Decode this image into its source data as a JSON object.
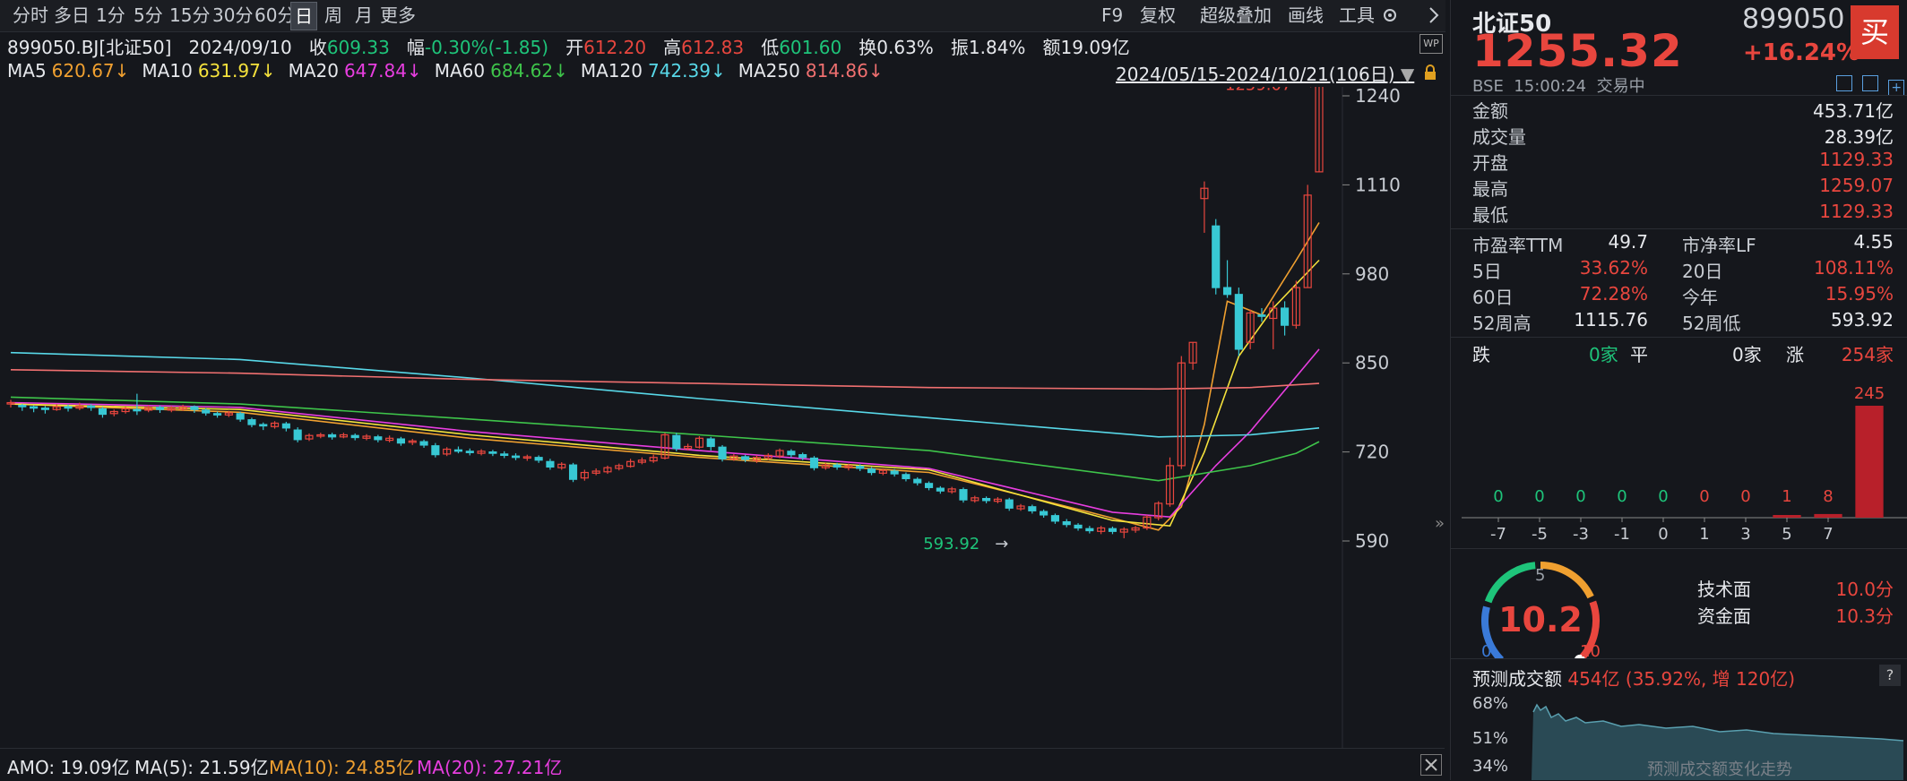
{
  "toolbar": {
    "periods": [
      "分时",
      "多日",
      "1分",
      "5分",
      "15分",
      "30分",
      "60分",
      "日",
      "周",
      "月",
      "更多"
    ],
    "active_period": "日",
    "right_items": [
      "F9",
      "复权",
      "超级叠加",
      "画线",
      "工具"
    ]
  },
  "info": {
    "code": "899050.BJ[北证50]",
    "date": "2024/09/10",
    "close_label": "收",
    "close": "609.33",
    "amp_label": "幅",
    "amp": "-0.30%(-1.85)",
    "open_label": "开",
    "open": "612.20",
    "high_label": "高",
    "high": "612.83",
    "low_label": "低",
    "low": "601.60",
    "turnover_label": "换",
    "turnover": "0.63%",
    "swing_label": "振",
    "swing": "1.84%",
    "amount_label": "额",
    "amount": "19.09亿"
  },
  "ma_legend": [
    {
      "name": "MA5",
      "value": "620.67↓",
      "color": "#f0a030"
    },
    {
      "name": "MA10",
      "value": "631.97↓",
      "color": "#f5e23c"
    },
    {
      "name": "MA20",
      "value": "647.84↓",
      "color": "#e83ee0"
    },
    {
      "name": "MA60",
      "value": "684.62↓",
      "color": "#3ec44a"
    },
    {
      "name": "MA120",
      "value": "742.39↓",
      "color": "#58d8e8"
    },
    {
      "name": "MA250",
      "value": "814.86↓",
      "color": "#f07070"
    }
  ],
  "range_label": "2024/05/15-2024/10/21(106日)",
  "chart_data": {
    "type": "candlestick",
    "y_ticks": [
      "1240",
      "1110",
      "980",
      "850",
      "720",
      "590"
    ],
    "y_tick_values": [
      1240,
      1110,
      980,
      850,
      720,
      590
    ],
    "ylim": [
      575,
      1270
    ],
    "high_marker": "1259.07",
    "low_marker": "593.92",
    "candles": [
      [
        790,
        792,
        785,
        796
      ],
      [
        788,
        786,
        780,
        790
      ],
      [
        786,
        784,
        778,
        788
      ],
      [
        784,
        782,
        776,
        787
      ],
      [
        782,
        786,
        780,
        790
      ],
      [
        786,
        784,
        779,
        789
      ],
      [
        784,
        787,
        781,
        792
      ],
      [
        787,
        785,
        780,
        790
      ],
      [
        783,
        775,
        770,
        786
      ],
      [
        776,
        779,
        772,
        782
      ],
      [
        779,
        783,
        776,
        786
      ],
      [
        782,
        780,
        774,
        805
      ],
      [
        781,
        785,
        778,
        788
      ],
      [
        785,
        782,
        777,
        788
      ],
      [
        781,
        784,
        778,
        787
      ],
      [
        783,
        786,
        780,
        789
      ],
      [
        786,
        782,
        777,
        788
      ],
      [
        781,
        777,
        773,
        784
      ],
      [
        776,
        775,
        770,
        779
      ],
      [
        774,
        777,
        771,
        780
      ],
      [
        776,
        768,
        764,
        779
      ],
      [
        767,
        760,
        756,
        770
      ],
      [
        760,
        758,
        752,
        763
      ],
      [
        757,
        762,
        754,
        765
      ],
      [
        761,
        755,
        750,
        764
      ],
      [
        752,
        738,
        734,
        756
      ],
      [
        739,
        744,
        736,
        747
      ],
      [
        743,
        745,
        740,
        748
      ],
      [
        745,
        742,
        738,
        748
      ],
      [
        742,
        745,
        740,
        748
      ],
      [
        744,
        741,
        737,
        747
      ],
      [
        740,
        743,
        737,
        746
      ],
      [
        742,
        738,
        734,
        745
      ],
      [
        737,
        740,
        734,
        744
      ],
      [
        739,
        733,
        729,
        742
      ],
      [
        734,
        736,
        730,
        739
      ],
      [
        735,
        730,
        726,
        738
      ],
      [
        729,
        716,
        712,
        733
      ],
      [
        717,
        724,
        714,
        727
      ],
      [
        723,
        722,
        718,
        728
      ],
      [
        721,
        719,
        715,
        725
      ],
      [
        718,
        721,
        715,
        724
      ],
      [
        720,
        718,
        714,
        723
      ],
      [
        717,
        715,
        711,
        721
      ],
      [
        714,
        712,
        708,
        718
      ],
      [
        711,
        713,
        707,
        716
      ],
      [
        712,
        708,
        704,
        715
      ],
      [
        706,
        698,
        694,
        710
      ],
      [
        697,
        702,
        694,
        705
      ],
      [
        701,
        680,
        676,
        704
      ],
      [
        682,
        690,
        678,
        694
      ],
      [
        689,
        692,
        686,
        696
      ],
      [
        691,
        697,
        688,
        700
      ],
      [
        696,
        700,
        693,
        703
      ],
      [
        699,
        706,
        697,
        710
      ],
      [
        705,
        708,
        702,
        712
      ],
      [
        707,
        712,
        704,
        716
      ],
      [
        711,
        745,
        709,
        748
      ],
      [
        744,
        725,
        721,
        748
      ],
      [
        725,
        728,
        722,
        732
      ],
      [
        727,
        740,
        725,
        743
      ],
      [
        739,
        728,
        722,
        742
      ],
      [
        727,
        710,
        706,
        730
      ],
      [
        710,
        714,
        707,
        717
      ],
      [
        713,
        709,
        705,
        716
      ],
      [
        708,
        712,
        704,
        715
      ],
      [
        711,
        715,
        708,
        718
      ],
      [
        714,
        722,
        711,
        725
      ],
      [
        721,
        716,
        712,
        724
      ],
      [
        716,
        712,
        708,
        719
      ],
      [
        711,
        697,
        693,
        714
      ],
      [
        697,
        701,
        694,
        704
      ],
      [
        701,
        698,
        694,
        704
      ],
      [
        697,
        700,
        693,
        703
      ],
      [
        699,
        696,
        692,
        702
      ],
      [
        695,
        690,
        686,
        698
      ],
      [
        689,
        693,
        686,
        696
      ],
      [
        692,
        688,
        684,
        695
      ],
      [
        687,
        681,
        677,
        690
      ],
      [
        680,
        675,
        671,
        683
      ],
      [
        674,
        668,
        664,
        677
      ],
      [
        667,
        663,
        659,
        670
      ],
      [
        662,
        666,
        659,
        669
      ],
      [
        665,
        650,
        646,
        668
      ],
      [
        649,
        653,
        646,
        656
      ],
      [
        652,
        649,
        645,
        655
      ],
      [
        648,
        651,
        645,
        654
      ],
      [
        650,
        638,
        634,
        653
      ],
      [
        637,
        641,
        634,
        644
      ],
      [
        640,
        634,
        630,
        643
      ],
      [
        633,
        628,
        624,
        636
      ],
      [
        627,
        619,
        615,
        630
      ],
      [
        618,
        614,
        610,
        622
      ],
      [
        613,
        609,
        605,
        616
      ],
      [
        608,
        605,
        601,
        612
      ],
      [
        604,
        609,
        600,
        612
      ],
      [
        608,
        604,
        600,
        611
      ],
      [
        603,
        607,
        594,
        610
      ],
      [
        606,
        609,
        602,
        612
      ],
      [
        609,
        625,
        606,
        628
      ],
      [
        624,
        645,
        620,
        648
      ],
      [
        644,
        700,
        640,
        712
      ],
      [
        700,
        850,
        695,
        860
      ],
      [
        850,
        880,
        840,
        880
      ],
      [
        1090,
        1105,
        1040,
        1115
      ],
      [
        1050,
        960,
        950,
        1060
      ],
      [
        960,
        950,
        945,
        1000
      ],
      [
        950,
        870,
        860,
        960
      ],
      [
        880,
        923,
        870,
        928
      ],
      [
        920,
        918,
        910,
        930
      ],
      [
        915,
        930,
        870,
        940
      ],
      [
        930,
        905,
        890,
        940
      ],
      [
        905,
        960,
        900,
        970
      ],
      [
        960,
        1095,
        960,
        1110
      ],
      [
        1129,
        1255,
        1129,
        1259
      ]
    ],
    "ma_lines": {
      "MA5": [
        [
          0,
          790
        ],
        [
          20,
          778
        ],
        [
          40,
          740
        ],
        [
          60,
          712
        ],
        [
          80,
          690
        ],
        [
          94,
          632
        ],
        [
          100,
          606
        ],
        [
          102,
          640
        ],
        [
          104,
          760
        ],
        [
          106,
          940
        ],
        [
          109,
          920
        ],
        [
          112,
          1000
        ],
        [
          114,
          1055
        ]
      ],
      "MA10": [
        [
          0,
          790
        ],
        [
          20,
          782
        ],
        [
          40,
          745
        ],
        [
          60,
          715
        ],
        [
          80,
          694
        ],
        [
          96,
          620
        ],
        [
          101,
          612
        ],
        [
          104,
          720
        ],
        [
          107,
          860
        ],
        [
          110,
          930
        ],
        [
          114,
          1000
        ]
      ],
      "MA20": [
        [
          0,
          792
        ],
        [
          20,
          785
        ],
        [
          40,
          750
        ],
        [
          60,
          722
        ],
        [
          80,
          696
        ],
        [
          96,
          632
        ],
        [
          101,
          625
        ],
        [
          105,
          700
        ],
        [
          108,
          750
        ],
        [
          112,
          830
        ],
        [
          114,
          870
        ]
      ],
      "MA60": [
        [
          0,
          800
        ],
        [
          20,
          790
        ],
        [
          40,
          768
        ],
        [
          60,
          745
        ],
        [
          80,
          722
        ],
        [
          100,
          678
        ],
        [
          108,
          700
        ],
        [
          112,
          718
        ],
        [
          114,
          735
        ]
      ],
      "MA120": [
        [
          0,
          865
        ],
        [
          20,
          855
        ],
        [
          40,
          828
        ],
        [
          60,
          798
        ],
        [
          80,
          770
        ],
        [
          100,
          742
        ],
        [
          108,
          745
        ],
        [
          114,
          755
        ]
      ],
      "MA250": [
        [
          0,
          840
        ],
        [
          20,
          835
        ],
        [
          40,
          826
        ],
        [
          60,
          820
        ],
        [
          80,
          814
        ],
        [
          100,
          812
        ],
        [
          108,
          814
        ],
        [
          114,
          820
        ]
      ]
    }
  },
  "amo": {
    "label": "AMO: 19.09亿",
    "ma5": "MA(5): 21.59亿",
    "ma10": "MA(10): 24.85亿",
    "ma20": "MA(20): 27.21亿"
  },
  "panel": {
    "name": "北证50",
    "code": "899050",
    "price": "1255.32",
    "change": "+16.24%",
    "buy": "买",
    "exchange": "BSE",
    "time": "15:00:24",
    "status": "交易中",
    "rows": [
      {
        "label": "金额",
        "value": "453.71亿",
        "color": "#e6e8ec"
      },
      {
        "label": "成交量",
        "value": "28.39亿",
        "color": "#e6e8ec"
      },
      {
        "label": "开盘",
        "value": "1129.33",
        "color": "#e8463e"
      },
      {
        "label": "最高",
        "value": "1259.07",
        "color": "#e8463e"
      },
      {
        "label": "最低",
        "value": "1129.33",
        "color": "#e8463e"
      }
    ],
    "grid": [
      {
        "l1": "市盈率TTM",
        "v1": "49.7",
        "c1": "#e6e8ec",
        "l2": "市净率LF",
        "v2": "4.55",
        "c2": "#e6e8ec"
      },
      {
        "l1": "5日",
        "v1": "33.62%",
        "c1": "#e8463e",
        "l2": "20日",
        "v2": "108.11%",
        "c2": "#e8463e"
      },
      {
        "l1": "60日",
        "v1": "72.28%",
        "c1": "#e8463e",
        "l2": "今年",
        "v2": "15.95%",
        "c2": "#e8463e"
      },
      {
        "l1": "52周高",
        "v1": "1115.76",
        "c1": "#e6e8ec",
        "l2": "52周低",
        "v2": "593.92",
        "c2": "#e6e8ec"
      }
    ],
    "breadth": {
      "fall_label": "跌",
      "fall": "0家",
      "flat_label": "平",
      "flat": "0家",
      "rise_label": "涨",
      "rise": "254家"
    },
    "dist": {
      "bins": [
        "-7",
        "-5",
        "-3",
        "-1",
        "0",
        "1",
        "3",
        "5",
        "7"
      ],
      "counts": [
        0,
        0,
        0,
        0,
        0,
        0,
        0,
        1,
        8,
        245
      ],
      "top_label": "245"
    },
    "gauge": {
      "value": "10.2",
      "min": "0",
      "mid": "5",
      "max": "10",
      "tech_label": "技术面",
      "tech": "10.0分",
      "fund_label": "资金面",
      "fund": "10.3分"
    },
    "forecast": {
      "label": "预测成交额",
      "value": "454亿 (35.92%, 增 120亿)",
      "help": "?",
      "y_labels": [
        "68%",
        "51%",
        "34%"
      ],
      "caption": "预测成交额变化走势"
    }
  }
}
